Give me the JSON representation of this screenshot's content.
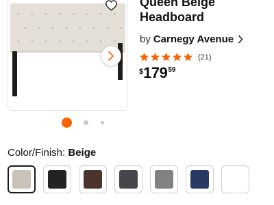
{
  "product": {
    "title": "Queen Beige Headboard",
    "brand_prefix": "by",
    "brand": "Carnegy Avenue",
    "rating": 5,
    "review_count": "(21)",
    "price": {
      "currency": "$",
      "dollars": "179",
      "cents": "59"
    }
  },
  "gallery": {
    "image_alt": "Beige tufted upholstered headboard",
    "slide_count": 3,
    "active_slide": 1
  },
  "color_finish": {
    "label": "Color/Finish:",
    "selected": "Beige",
    "swatches": [
      {
        "name": "Beige",
        "color": "#c9c2b8",
        "selected": true
      },
      {
        "name": "Black",
        "color": "#232323"
      },
      {
        "name": "Brown",
        "color": "#4a342b"
      },
      {
        "name": "Dark Gray",
        "color": "#46474d"
      },
      {
        "name": "Gray",
        "color": "#828284"
      },
      {
        "name": "Navy",
        "color": "#283a63"
      },
      {
        "name": "White",
        "color": "#ffffff"
      }
    ]
  },
  "colors": {
    "accent": "#f96302",
    "star": "#f96302"
  },
  "icons": {
    "favorite": "heart-outline-icon",
    "next": "chevron-right-icon",
    "brand_link": "chevron-right-icon"
  }
}
